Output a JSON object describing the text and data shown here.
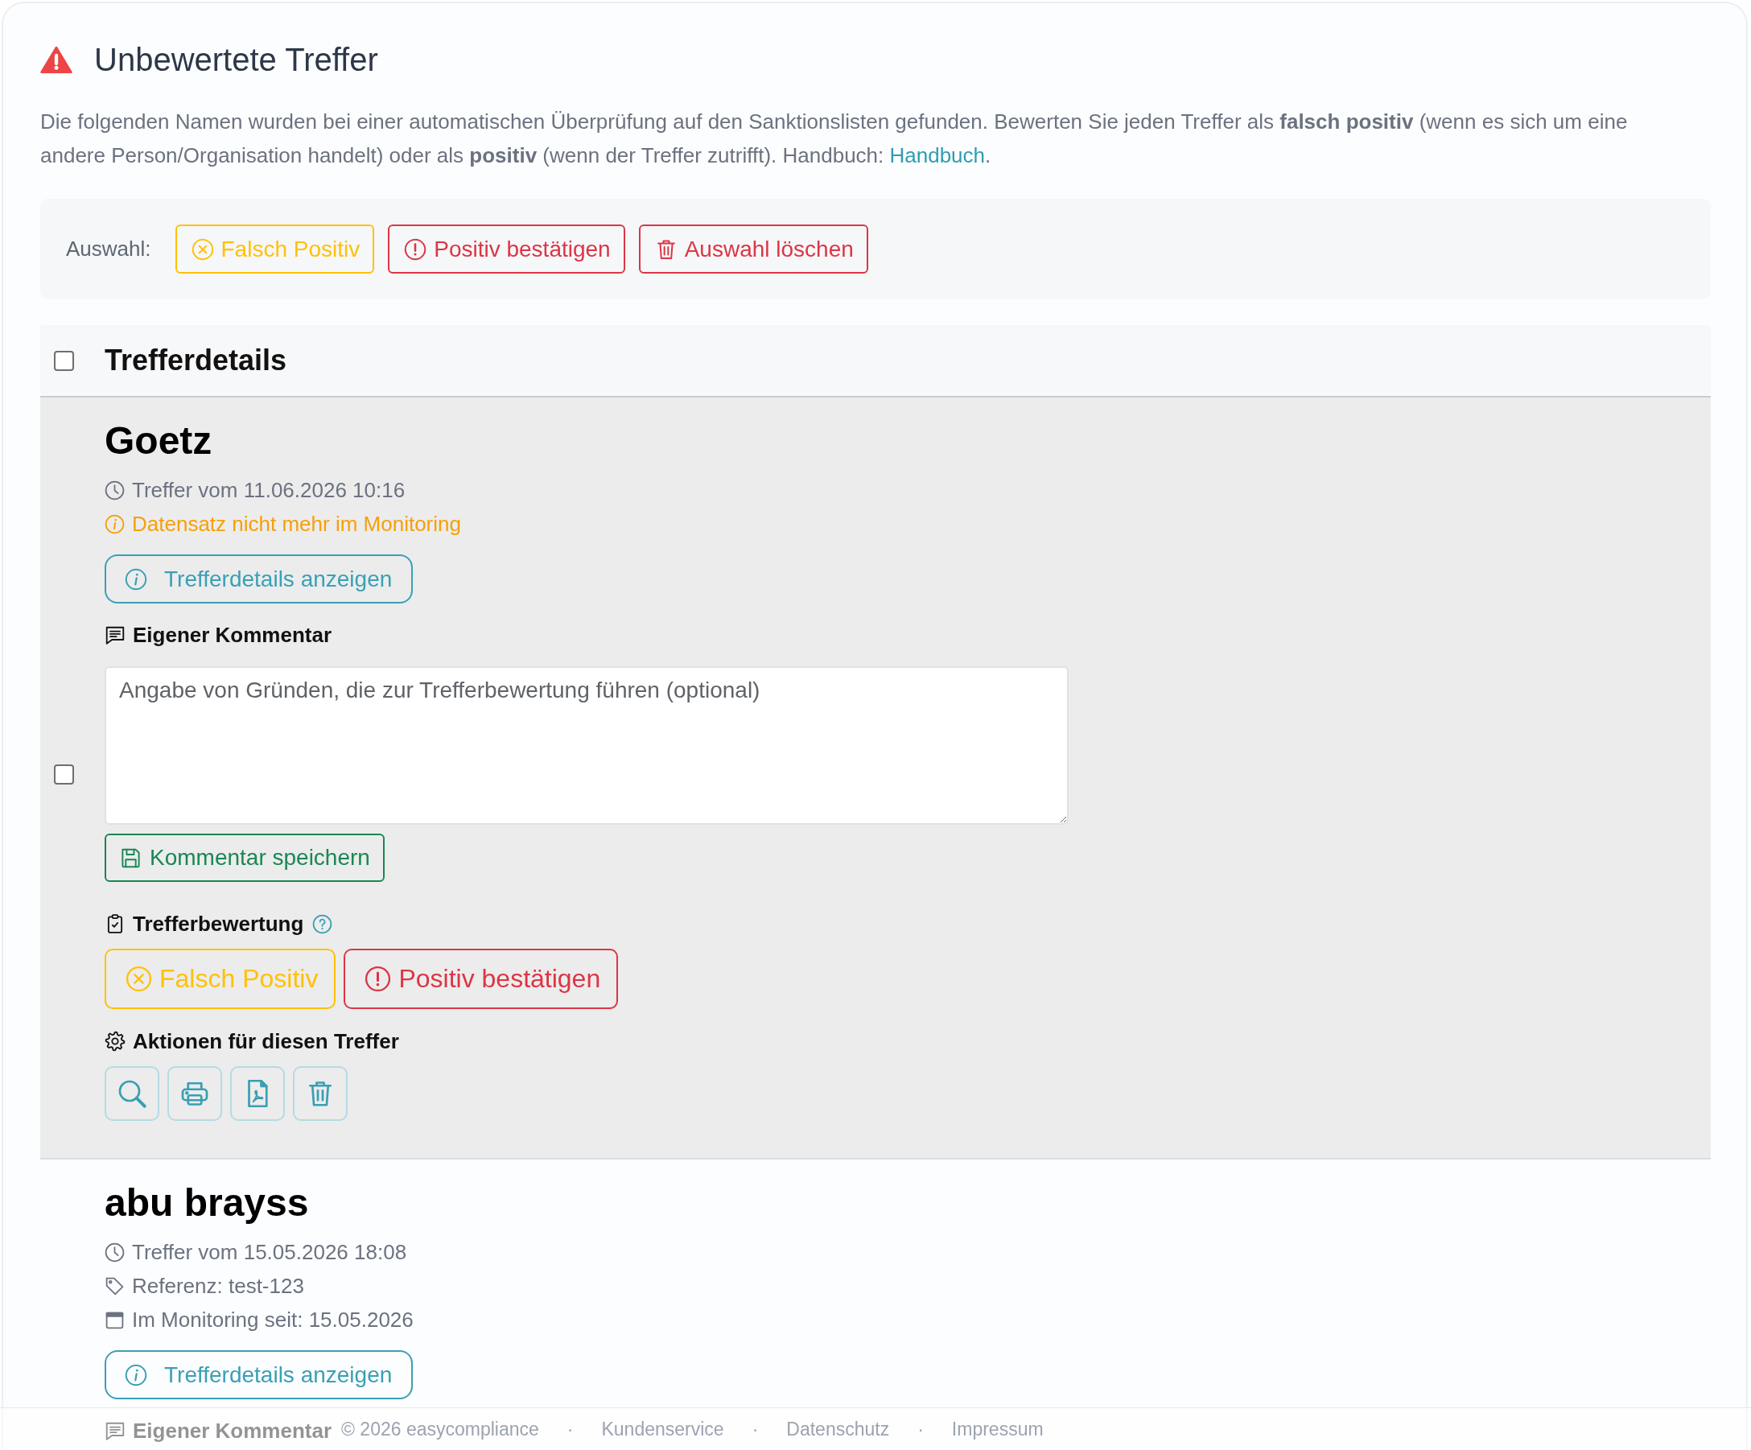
{
  "header": {
    "title": "Unbewertete Treffer",
    "description": {
      "text": "Die folgenden Namen wurden bei einer automatischen Überprüfung auf den Sanktionslisten gefunden. Bewerten Sie jeden Treffer als **falsch positiv** (wenn es sich um eine andere Person/Organisation handelt) oder als **positiv** (wenn der Treffer zutrifft). Handbuch: ",
      "link": "Handbuch",
      "after": "."
    }
  },
  "bulk_actions": {
    "label": "Auswahl:",
    "buttons": [
      {
        "kind": "false_positive",
        "label": "Falsch Positiv"
      },
      {
        "kind": "confirm_positive",
        "label": "Positiv bestätigen"
      },
      {
        "kind": "delete",
        "label": "Auswahl löschen"
      }
    ]
  },
  "table": {
    "header": {
      "checked": false,
      "title": "Trefferdetails"
    },
    "hits": [
      {
        "name": "Goetz",
        "greyed_out": true,
        "checked": false,
        "meta": [
          {
            "kind": "time",
            "text": "Treffer vom 11.06.2026 10:16"
          },
          {
            "kind": "warning",
            "text": "Datensatz nicht mehr im Monitoring"
          }
        ],
        "details_button": "Trefferdetails anzeigen",
        "comment": {
          "label": "Eigener Kommentar",
          "placeholder": "Angabe von Gründen, die zur Trefferbewertung führen (optional)",
          "save_button": "Kommentar speichern"
        },
        "rating": {
          "label": "Trefferbewertung",
          "buttons": [
            {
              "kind": "false_positive",
              "label": "Falsch Positiv"
            },
            {
              "kind": "confirm_positive",
              "label": "Positiv bestätigen"
            }
          ]
        },
        "actions": {
          "label": "Aktionen für diesen Treffer",
          "buttons": [
            {
              "kind": "search"
            },
            {
              "kind": "print"
            },
            {
              "kind": "pdf"
            },
            {
              "kind": "delete"
            }
          ]
        }
      },
      {
        "name": "abu brayss",
        "greyed_out": false,
        "meta": [
          {
            "kind": "time",
            "text": "Treffer vom 15.05.2026 18:08"
          },
          {
            "kind": "reference",
            "text": "Referenz: test-123"
          },
          {
            "kind": "monitoring",
            "text": "Im Monitoring seit: 15.05.2026"
          }
        ],
        "details_button": "Trefferdetails anzeigen",
        "comment": {
          "label": "Eigener Kommentar"
        }
      }
    ]
  },
  "footer": {
    "copyright": "© 2026 easycompliance",
    "links": [
      {
        "separator": "·",
        "label": "Kundenservice"
      },
      {
        "separator": "·",
        "label": "Datenschutz"
      },
      {
        "separator": "·",
        "label": "Impressum"
      }
    ]
  }
}
